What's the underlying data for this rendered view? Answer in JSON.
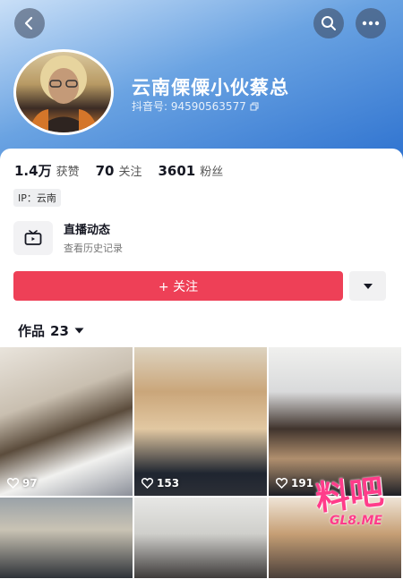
{
  "profile": {
    "nickname": "云南傈僳小伙蔡总",
    "douyin_id_label": "抖音号: 94590563577"
  },
  "stats": [
    {
      "num": "1.4万",
      "label": "获赞"
    },
    {
      "num": "70",
      "label": "关注"
    },
    {
      "num": "3601",
      "label": "粉丝"
    }
  ],
  "ip_tag": "IP：云南",
  "live": {
    "title": "直播动态",
    "subtitle": "查看历史记录"
  },
  "follow_button": "+ 关注",
  "works": {
    "label": "作品",
    "count": "23"
  },
  "videos": [
    {
      "likes": "97"
    },
    {
      "likes": "153"
    },
    {
      "likes": "191"
    },
    {
      "likes": ""
    },
    {
      "likes": ""
    },
    {
      "likes": ""
    }
  ],
  "watermark": {
    "main": "料吧",
    "sub": "GL8.ME"
  },
  "colors": {
    "accent": "#ee4057",
    "header_gradient_end": "#2f73d0"
  },
  "icons": [
    "back-arrow-icon",
    "search-icon",
    "more-icon",
    "copy-icon",
    "live-tv-icon",
    "chevron-down-icon",
    "heart-icon"
  ]
}
